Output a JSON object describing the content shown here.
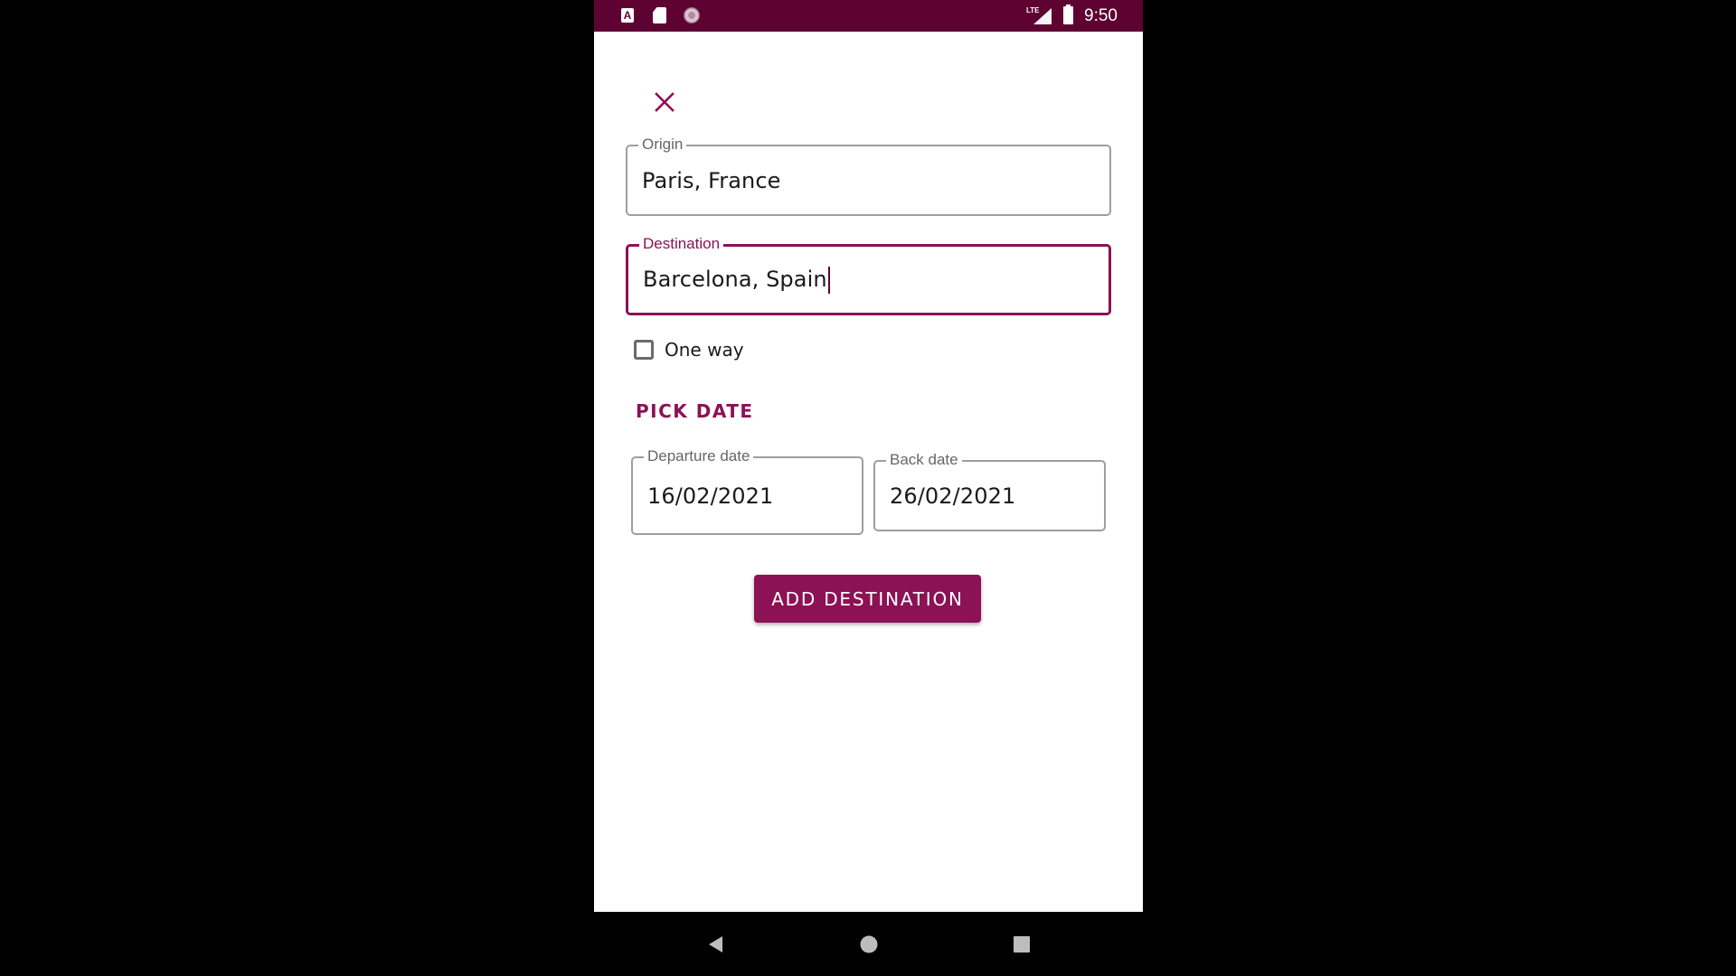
{
  "status_bar": {
    "time": "9:50",
    "network": "LTE",
    "icons": [
      "accessibility-a-icon",
      "sd-card-icon",
      "sync-circle-icon",
      "lte-signal-icon",
      "battery-icon"
    ]
  },
  "form": {
    "close_icon": "close-icon",
    "origin": {
      "label": "Origin",
      "value": "Paris, France"
    },
    "destination": {
      "label": "Destination",
      "value": "Barcelona, Spain",
      "focused": true
    },
    "one_way": {
      "label": "One way",
      "checked": false
    },
    "pick_date_label": "PICK DATE",
    "departure_date": {
      "label": "Departure date",
      "value": "16/02/2021"
    },
    "back_date": {
      "label": "Back date",
      "value": "26/02/2021"
    },
    "submit_label": "ADD DESTINATION"
  },
  "nav_bar": {
    "icons": [
      "back-icon",
      "home-icon",
      "recents-icon"
    ]
  },
  "colors": {
    "accent": "#8c1155",
    "status_bar": "#5e0232",
    "background": "#ffffff"
  }
}
